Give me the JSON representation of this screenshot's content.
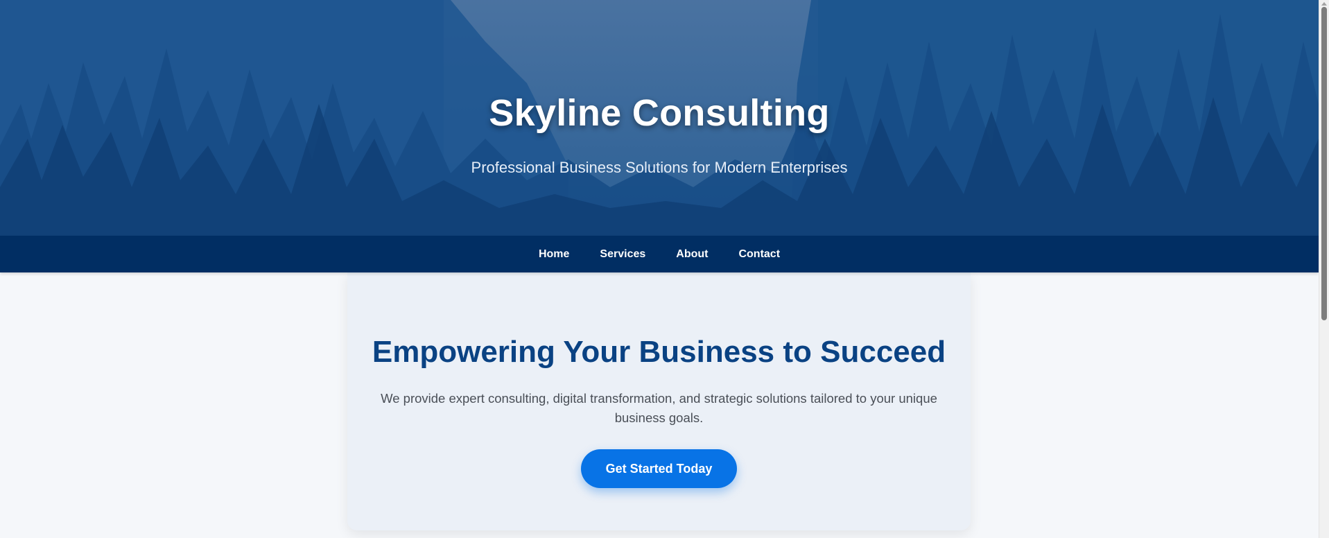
{
  "hero": {
    "title": "Skyline Consulting",
    "subtitle": "Professional Business Solutions for Modern Enterprises"
  },
  "nav": {
    "items": [
      {
        "label": "Home"
      },
      {
        "label": "Services"
      },
      {
        "label": "About"
      },
      {
        "label": "Contact"
      }
    ]
  },
  "main": {
    "heading": "Empowering Your Business to Succeed",
    "description": "We provide expert consulting, digital transformation, and strategic solutions tailored to your unique business goals.",
    "cta_label": "Get Started Today"
  },
  "colors": {
    "hero_overlay": "#1f5790",
    "nav_background": "#012e63",
    "heading": "#0a4283",
    "cta": "#0873e6",
    "card_background": "#ebf0f7",
    "page_background": "#f5f7fa"
  }
}
